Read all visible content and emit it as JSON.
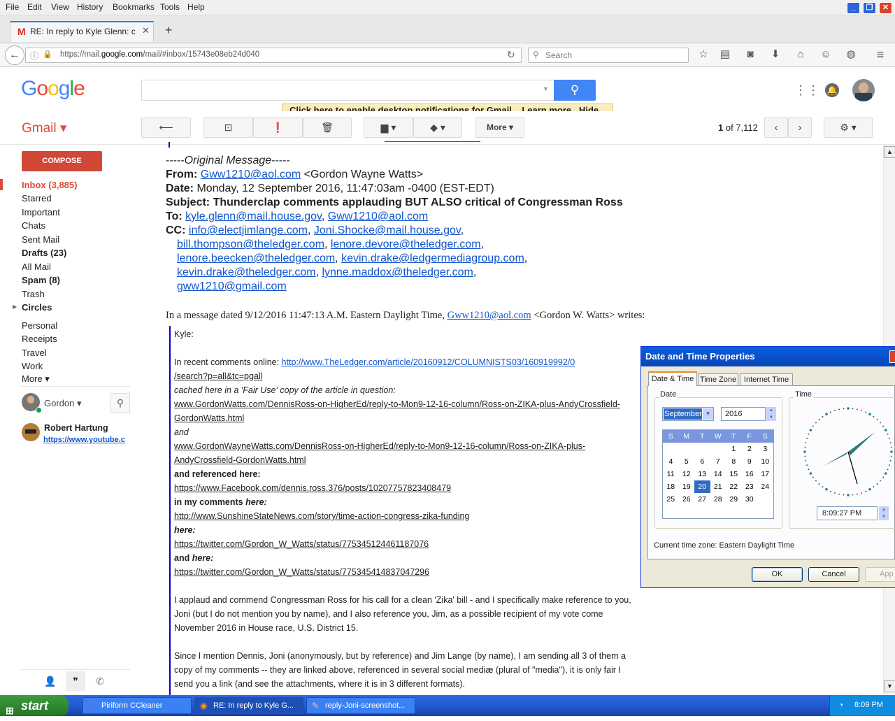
{
  "menu": [
    "File",
    "Edit",
    "View",
    "History",
    "Bookmarks",
    "Tools",
    "Help"
  ],
  "tab": {
    "title": "RE: In reply to Kyle Glenn: cc..."
  },
  "address": {
    "url_prefix": "https://mail.",
    "url_domain": "google.com",
    "url_suffix": "/mail/#inbox/15743e08eb24d040"
  },
  "search": {
    "placeholder": "Search"
  },
  "gmail": {
    "logo": "Google",
    "label": "Gmail ▾",
    "notify_link": "Click here to enable",
    "notify_text": " desktop notifications for Gmail.",
    "notify_learn": "Learn more",
    "notify_hide": "Hide",
    "more_label": "More ▾",
    "pager_bold": "1",
    "pager_rest": " of 7,112"
  },
  "sidebar": {
    "compose": "COMPOSE",
    "items": [
      "Inbox (3,885)",
      "Starred",
      "Important",
      "Chats",
      "Sent Mail",
      "Drafts (23)",
      "All Mail",
      "Spam (8)",
      "Trash",
      "Circles",
      "Personal",
      "Receipts",
      "Travel",
      "Work",
      "More ▾"
    ],
    "user": "Gordon ▾",
    "contact_name": "Robert Hartung",
    "contact_link": "https://www.youtube.c"
  },
  "message": {
    "orig": "-----",
    "orig_italic": "Original Message",
    "orig_end": "-----",
    "from_label": "From:",
    "from_link": "Gww1210@aol.com",
    "from_rest": " <Gordon Wayne Watts>",
    "date_label": "Date:",
    "date_value": " Monday, 12 September 2016, 11:47:03am -0400 (EST-EDT)",
    "subject": "Subject: Thunderclap comments applauding BUT ALSO critical of Congressman Ross",
    "to_label": "To:",
    "to_1": "kyle.glenn@mail.house.gov",
    "to_2": "Gww1210@aol.com",
    "cc_label": "CC:",
    "cc_1": "info@electjimlange.com",
    "cc_2": "Joni.Shocke@mail.house.gov",
    "cc_3": "bill.thompson@theledger.com",
    "cc_4": "lenore.devore@theledger.com",
    "cc_5": "lenore.beecken@theledger.com",
    "cc_6": "kevin.drake@ledgermediagroup.com",
    "cc_7": "kevin.drake@theledger.com",
    "cc_8": "lynne.maddox@theledger.com",
    "cc_9": "gww1210@gmail.com",
    "dated_pre": "In a message dated 9/12/2016 11:47:13 A.M. Eastern Daylight Time, ",
    "dated_link": "Gww1210@aol.com",
    "dated_post": " <Gordon W. Watts> writes:",
    "greet": "Kyle:",
    "recent": "In recent comments online: ",
    "link1a": "http://www.TheLedger.com/article/20160912/COLUMNISTS03/160919992/0",
    "link1b": "/search?p=all&tc=pgall",
    "cached": "cached here in a 'Fair Use' copy of the article in question:",
    "link2a": "www.GordonWatts.com/DennisRoss-on-HigherEd/reply-to-Mon9-12-16-column/Ross-on-ZIKA-plus-AndyCrossfield-",
    "link2b": "GordonWatts.html",
    "and1": "and",
    "link3a": "www.GordonWayneWatts.com/DennisRoss-on-HigherEd/reply-to-Mon9-12-16-column/Ross-on-ZIKA-plus-",
    "link3b": "AndyCrossfield-GordonWatts.html",
    "ref": "and referenced here:",
    "link4": "https://www.Facebook.com/dennis.ross.376/posts/10207757823408479",
    "mycomm": "in my comments ",
    "mycomm_here": "here:",
    "link5": "http://www.SunshineStateNews.com/story/time-action-congress-zika-funding",
    "here2": "here:",
    "link6": "https://twitter.com/Gordon_W_Watts/status/775345124461187076",
    "andhere": "and ",
    "andhere_here": "here:",
    "link7": "https://twitter.com/Gordon_W_Watts/status/775345414837047296",
    "p1a": "I applaud and commend Congressman Ross for his call for a clean 'Zika' bill - and I specifically make reference to you,",
    "p1b": "Joni (but I do not mention you by name), and I also reference you, Jim, as a possible recipient of my vote come",
    "p1c": "November 2016 in House race, U.S. District 15.",
    "p2a": "Since I mention Dennis, Joni (anonymously, but by reference) and Jim Lange (by name), I am sending all 3 of them a",
    "p2b": "copy of my comments -- they are linked above, referenced in several social mediæ (plural of \"media\"), it is only fair I",
    "p2c": "send you a link (and see the attachments, where it is in 3 different formats)."
  },
  "dialog": {
    "title": "Date and Time Properties",
    "tabs": [
      "Date & Time",
      "Time Zone",
      "Internet Time"
    ],
    "date_group": "Date",
    "time_group": "Time",
    "month": "September",
    "year": "2016",
    "weekdays": [
      "S",
      "M",
      "T",
      "W",
      "T",
      "F",
      "S"
    ],
    "weeks": [
      [
        "",
        "",
        "",
        "",
        "1",
        "2",
        "3"
      ],
      [
        "4",
        "5",
        "6",
        "7",
        "8",
        "9",
        "10"
      ],
      [
        "11",
        "12",
        "13",
        "14",
        "15",
        "16",
        "17"
      ],
      [
        "18",
        "19",
        "20",
        "21",
        "22",
        "23",
        "24"
      ],
      [
        "25",
        "26",
        "27",
        "28",
        "29",
        "30",
        ""
      ]
    ],
    "selected_day": "20",
    "time": "8:09:27 PM",
    "tz_label": "Current time zone:  Eastern Daylight Time",
    "ok": "OK",
    "cancel": "Cancel",
    "apply": "App"
  },
  "taskbar": {
    "start": "start",
    "tasks": [
      "Piriform CCleaner",
      "RE: In reply to Kyle G...",
      "reply-Joni-screenshot..."
    ],
    "clock": "8:09 PM"
  }
}
